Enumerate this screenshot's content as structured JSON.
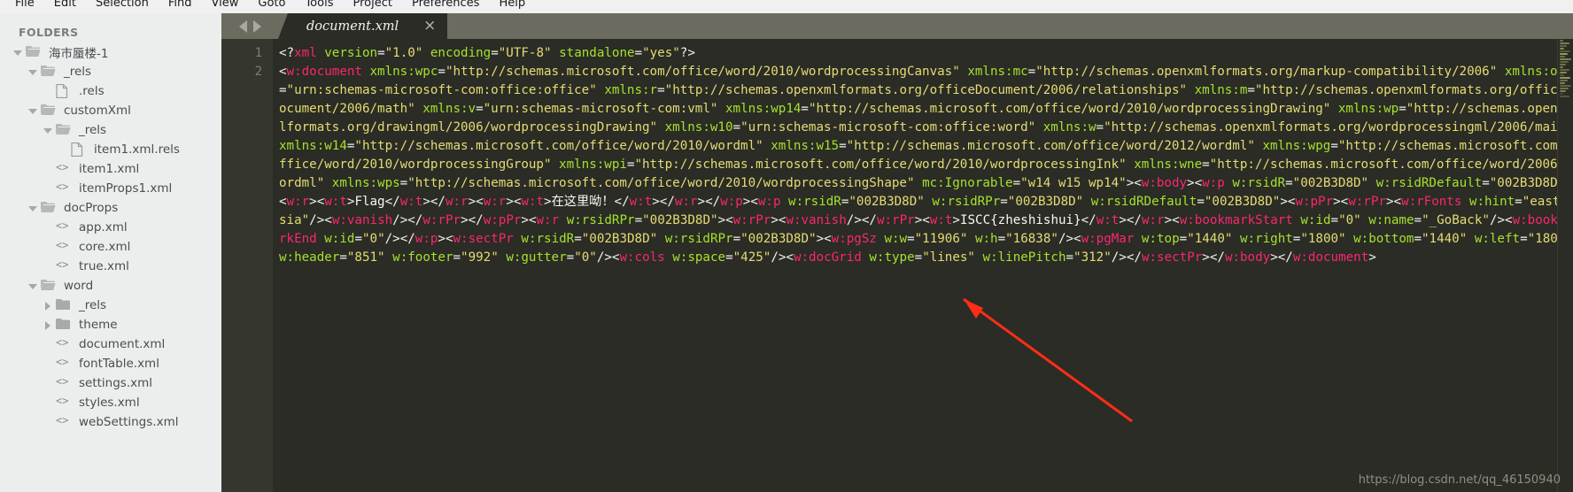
{
  "menubar": {
    "items": [
      "File",
      "Edit",
      "Selection",
      "Find",
      "View",
      "Goto",
      "Tools",
      "Project",
      "Preferences",
      "Help"
    ]
  },
  "sidebar": {
    "header": "FOLDERS",
    "tree": [
      {
        "label": "海市蜃楼-1",
        "depth": 0,
        "arrow": "down",
        "icon": "folder-open-icon"
      },
      {
        "label": "_rels",
        "depth": 1,
        "arrow": "down",
        "icon": "folder-open-icon"
      },
      {
        "label": ".rels",
        "depth": 2,
        "arrow": "none",
        "icon": "file-icon"
      },
      {
        "label": "customXml",
        "depth": 1,
        "arrow": "down",
        "icon": "folder-open-icon"
      },
      {
        "label": "_rels",
        "depth": 2,
        "arrow": "down",
        "icon": "folder-open-icon"
      },
      {
        "label": "item1.xml.rels",
        "depth": 3,
        "arrow": "none",
        "icon": "file-icon"
      },
      {
        "label": "item1.xml",
        "depth": 2,
        "arrow": "none",
        "icon": "code-file-icon"
      },
      {
        "label": "itemProps1.xml",
        "depth": 2,
        "arrow": "none",
        "icon": "code-file-icon"
      },
      {
        "label": "docProps",
        "depth": 1,
        "arrow": "down",
        "icon": "folder-open-icon"
      },
      {
        "label": "app.xml",
        "depth": 2,
        "arrow": "none",
        "icon": "code-file-icon"
      },
      {
        "label": "core.xml",
        "depth": 2,
        "arrow": "none",
        "icon": "code-file-icon"
      },
      {
        "label": "true.xml",
        "depth": 2,
        "arrow": "none",
        "icon": "code-file-icon"
      },
      {
        "label": "word",
        "depth": 1,
        "arrow": "down",
        "icon": "folder-open-icon"
      },
      {
        "label": "_rels",
        "depth": 2,
        "arrow": "right",
        "icon": "folder-closed-icon"
      },
      {
        "label": "theme",
        "depth": 2,
        "arrow": "right",
        "icon": "folder-closed-icon"
      },
      {
        "label": "document.xml",
        "depth": 2,
        "arrow": "none",
        "icon": "code-file-icon"
      },
      {
        "label": "fontTable.xml",
        "depth": 2,
        "arrow": "none",
        "icon": "code-file-icon"
      },
      {
        "label": "settings.xml",
        "depth": 2,
        "arrow": "none",
        "icon": "code-file-icon"
      },
      {
        "label": "styles.xml",
        "depth": 2,
        "arrow": "none",
        "icon": "code-file-icon"
      },
      {
        "label": "webSettings.xml",
        "depth": 2,
        "arrow": "none",
        "icon": "code-file-icon"
      }
    ]
  },
  "tabbar": {
    "prev_icon": "arrow-left-icon",
    "next_icon": "arrow-right-icon",
    "tabs": [
      {
        "title": "document.xml",
        "active": true,
        "close_glyph": "×"
      }
    ]
  },
  "editor": {
    "line_numbers": [
      "1",
      "2"
    ],
    "lines": [
      "<?xml version=\"1.0\" encoding=\"UTF-8\" standalone=\"yes\"?>",
      "<w:document xmlns:wpc=\"http://schemas.microsoft.com/office/word/2010/wordprocessingCanvas\" xmlns:mc=\"http://schemas.openxmlformats.org/markup-compatibility/2006\" xmlns:o=\"urn:schemas-microsoft-com:office:office\" xmlns:r=\"http://schemas.openxmlformats.org/officeDocument/2006/relationships\" xmlns:m=\"http://schemas.openxmlformats.org/officeDocument/2006/math\" xmlns:v=\"urn:schemas-microsoft-com:vml\" xmlns:wp14=\"http://schemas.microsoft.com/office/word/2010/wordprocessingDrawing\" xmlns:wp=\"http://schemas.openxmlformats.org/drawingml/2006/wordprocessingDrawing\" xmlns:w10=\"urn:schemas-microsoft-com:office:word\" xmlns:w=\"http://schemas.openxmlformats.org/wordprocessingml/2006/main\" xmlns:w14=\"http://schemas.microsoft.com/office/word/2010/wordml\" xmlns:w15=\"http://schemas.microsoft.com/office/word/2012/wordml\" xmlns:wpg=\"http://schemas.microsoft.com/office/word/2010/wordprocessingGroup\" xmlns:wpi=\"http://schemas.microsoft.com/office/word/2010/wordprocessingInk\" xmlns:wne=\"http://schemas.microsoft.com/office/word/2006/wordml\" xmlns:wps=\"http://schemas.microsoft.com/office/word/2010/wordprocessingShape\" mc:Ignorable=\"w14 w15 wp14\"><w:body><w:p w:rsidR=\"002B3D8D\" w:rsidRDefault=\"002B3D8D\"><w:r><w:t>Flag</w:t></w:r><w:r><w:t>在这里呦！</w:t></w:r></w:p><w:p w:rsidR=\"002B3D8D\" w:rsidRPr=\"002B3D8D\" w:rsidRDefault=\"002B3D8D\"><w:pPr><w:rPr><w:rFonts w:hint=\"eastAsia\"/><w:vanish/></w:rPr></w:pPr><w:r w:rsidRPr=\"002B3D8D\"><w:rPr><w:vanish/></w:rPr><w:t>ISCC{zheshishui}</w:t></w:r><w:bookmarkStart w:id=\"0\" w:name=\"_GoBack\"/><w:bookmarkEnd w:id=\"0\"/></w:p><w:sectPr w:rsidR=\"002B3D8D\" w:rsidRPr=\"002B3D8D\"><w:pgSz w:w=\"11906\" w:h=\"16838\"/><w:pgMar w:top=\"1440\" w:right=\"1800\" w:bottom=\"1440\" w:left=\"1800\" w:header=\"851\" w:footer=\"992\" w:gutter=\"0\"/><w:cols w:space=\"425\"/><w:docGrid w:type=\"lines\" w:linePitch=\"312\"/></w:sectPr></w:body></w:document>"
    ],
    "flag_text": "ISCC{zheshishui}",
    "chinese_text": "在这里呦！"
  },
  "watermark": {
    "text": "https://blog.csdn.net/qq_46150940"
  },
  "colors": {
    "editor_bg": "#2a2c25",
    "gutter_bg": "#35372e",
    "sidebar_bg": "#eceded",
    "tabbar_bg": "#6b6b60",
    "tag": "#f92672",
    "attribute": "#a6e22e",
    "string": "#e6db74",
    "text": "#f8f8f2",
    "annotation_arrow": "#ff2d16"
  }
}
